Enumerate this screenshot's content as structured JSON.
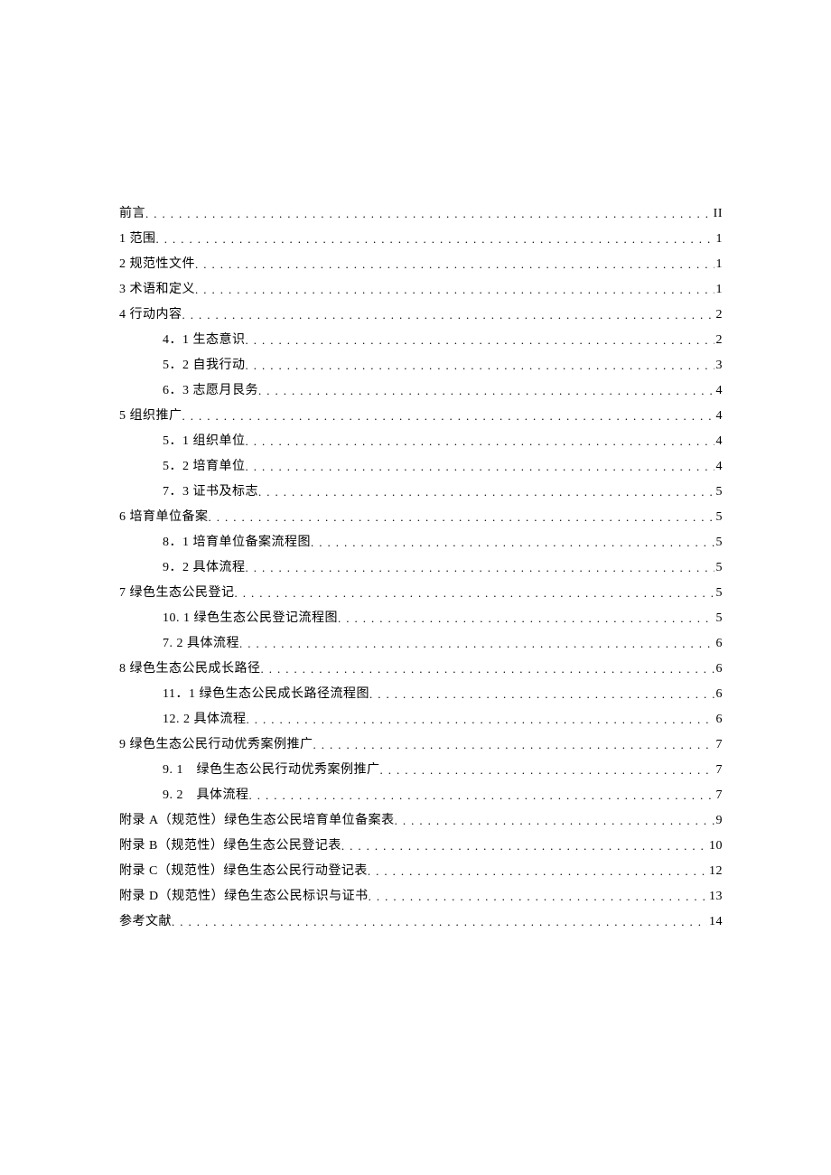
{
  "toc": [
    {
      "label": "前言",
      "page": "II",
      "indent": 0
    },
    {
      "label": "1 范围",
      "page": "1",
      "indent": 0
    },
    {
      "label": "2 规范性文件",
      "page": "1",
      "indent": 0
    },
    {
      "label": "3 术语和定义",
      "page": "1",
      "indent": 0
    },
    {
      "label": "4 行动内容",
      "page": "2",
      "indent": 0
    },
    {
      "label": "4．1 生态意识",
      "page": "2",
      "indent": 1
    },
    {
      "label": "5．2 自我行动",
      "page": "3",
      "indent": 1
    },
    {
      "label": "6．3 志愿月艮务",
      "page": "4",
      "indent": 1
    },
    {
      "label": "5 组织推广",
      "page": "4",
      "indent": 0
    },
    {
      "label": "5．1 组织单位",
      "page": "4",
      "indent": 1
    },
    {
      "label": "5．2 培育单位",
      "page": "4",
      "indent": 1
    },
    {
      "label": "7．3 证书及标志",
      "page": "5",
      "indent": 1
    },
    {
      "label": "6 培育单位备案",
      "page": "5",
      "indent": 0
    },
    {
      "label": "8．1 培育单位备案流程图",
      "page": "5",
      "indent": 1
    },
    {
      "label": "9．2 具体流程",
      "page": "5",
      "indent": 1
    },
    {
      "label": "7 绿色生态公民登记",
      "page": "5",
      "indent": 0
    },
    {
      "label": "10. 1 绿色生态公民登记流程图",
      "page": "5",
      "indent": 1
    },
    {
      "label": "7. 2 具体流程",
      "page": "6",
      "indent": 1
    },
    {
      "label": "8 绿色生态公民成长路径",
      "page": "6",
      "indent": 0
    },
    {
      "label": "11．1 绿色生态公民成长路径流程图",
      "page": "6",
      "indent": 1
    },
    {
      "label": "12. 2 具体流程",
      "page": "6",
      "indent": 1
    },
    {
      "label": "9 绿色生态公民行动优秀案例推广",
      "page": "7",
      "indent": 0
    },
    {
      "label": "9. 1　绿色生态公民行动优秀案例推广",
      "page": "7",
      "indent": 1
    },
    {
      "label": "9. 2　具体流程",
      "page": "7",
      "indent": 1
    },
    {
      "label": "附录 A（规范性）绿色生态公民培育单位备案表",
      "page": "9",
      "indent": 0
    },
    {
      "label": "附录 B（规范性）绿色生态公民登记表",
      "page": "10",
      "indent": 0
    },
    {
      "label": "附录 C（规范性）绿色生态公民行动登记表",
      "page": "12",
      "indent": 0
    },
    {
      "label": "附录 D（规范性）绿色生态公民标识与证书",
      "page": "13",
      "indent": 0
    },
    {
      "label": "参考文献",
      "page": "14",
      "indent": 0
    }
  ]
}
